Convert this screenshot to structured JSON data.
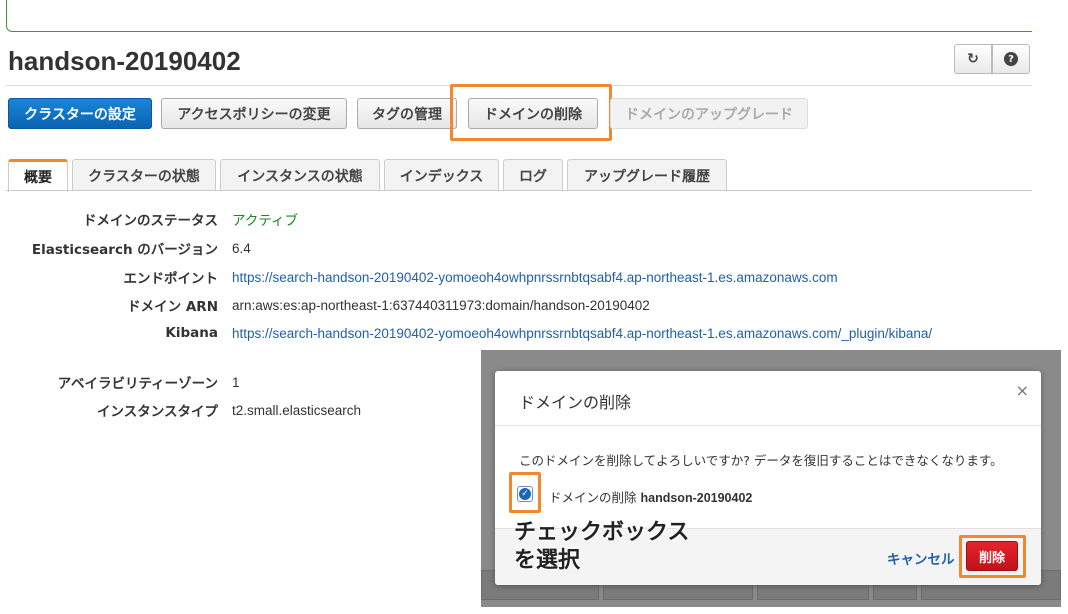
{
  "page": {
    "title": "handson-20190402",
    "refresh_icon": "refresh-icon",
    "help_icon": "help-icon"
  },
  "actions": {
    "cluster_settings": "クラスターの設定",
    "access_policy": "アクセスポリシーの変更",
    "tags": "タグの管理",
    "delete_domain": "ドメインの削除",
    "upgrade_domain": "ドメインのアップグレード"
  },
  "tabs": [
    {
      "label": "概要"
    },
    {
      "label": "クラスターの状態"
    },
    {
      "label": "インスタンスの状態"
    },
    {
      "label": "インデックス"
    },
    {
      "label": "ログ"
    },
    {
      "label": "アップグレード履歴"
    }
  ],
  "overview": {
    "status_label": "ドメインのステータス",
    "status_value": "アクティブ",
    "version_label": "Elasticsearch のバージョン",
    "version_value": "6.4",
    "endpoint_label": "エンドポイント",
    "endpoint_value": "https://search-handson-20190402-yomoeoh4owhpnrssrnbtqsabf4.ap-northeast-1.es.amazonaws.com",
    "arn_label": "ドメイン ARN",
    "arn_value": "arn:aws:es:ap-northeast-1:637440311973:domain/handson-20190402",
    "kibana_label": "Kibana",
    "kibana_value": "https://search-handson-20190402-yomoeoh4owhpnrssrnbtqsabf4.ap-northeast-1.es.amazonaws.com/_plugin/kibana/",
    "az_label": "アベイラビリティーゾーン",
    "az_value": "1",
    "instance_type_label": "インスタンスタイプ",
    "instance_type_value": "t2.small.elasticsearch"
  },
  "modal": {
    "title": "ドメインの削除",
    "close_symbol": "×",
    "message": "このドメインを削除してよろしいですか? データを復旧することはできなくなります。",
    "confirm_prefix": "ドメインの削除",
    "confirm_domain": "handson-20190402",
    "checkbox_checked": true,
    "cancel_label": "キャンセル",
    "delete_label": "削除"
  },
  "annotation": {
    "line1": "チェックボックス",
    "line2": "を選択"
  },
  "colors": {
    "highlight": "#f0892e",
    "primary": "#0a64b2",
    "danger": "#d0181f",
    "link": "#1f5fab",
    "status_active": "#1d8a1d"
  }
}
